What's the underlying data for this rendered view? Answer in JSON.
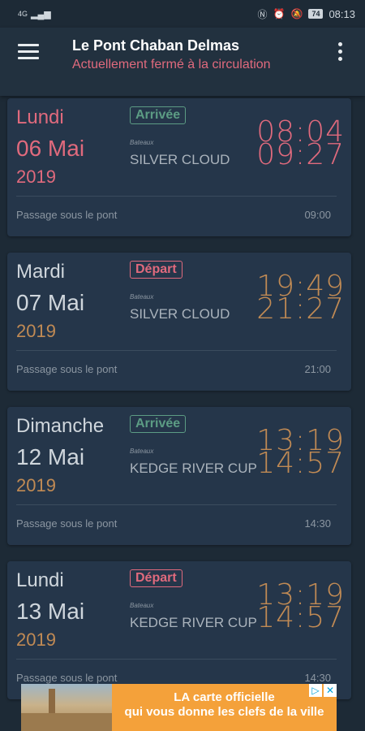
{
  "status_bar": {
    "network": "4G",
    "icons": [
      "nfc-icon",
      "alarm-icon",
      "mute-icon"
    ],
    "battery": "74",
    "time": "08:13"
  },
  "header": {
    "title": "Le Pont Chaban Delmas",
    "subtitle": "Actuellement fermé à la circulation"
  },
  "colors": {
    "accent_red": "#e06a7d",
    "accent_gold": "#c08a54",
    "accent_green": "#5c9c84",
    "card_bg": "#25364a",
    "app_bg": "#1d2a36"
  },
  "cards": [
    {
      "day": "Lundi",
      "date": "06 Mai",
      "year": "2019",
      "type": "Arrivée",
      "ship_logo": "Bateaux",
      "ship": "SILVER CLOUD",
      "time1": "08:04",
      "time2": "09:27",
      "passage_label": "Passage sous le pont",
      "passage_time": "09:00"
    },
    {
      "day": "Mardi",
      "date": "07 Mai",
      "year": "2019",
      "type": "Départ",
      "ship_logo": "Bateaux",
      "ship": "SILVER CLOUD",
      "time1": "19:49",
      "time2": "21:27",
      "passage_label": "Passage sous le pont",
      "passage_time": "21:00"
    },
    {
      "day": "Dimanche",
      "date": "12 Mai",
      "year": "2019",
      "type": "Arrivée",
      "ship_logo": "Bateaux",
      "ship": "KEDGE RIVER CUP",
      "time1": "13:19",
      "time2": "14:57",
      "passage_label": "Passage sous le pont",
      "passage_time": "14:30"
    },
    {
      "day": "Lundi",
      "date": "13 Mai",
      "year": "2019",
      "type": "Départ",
      "ship_logo": "Bateaux",
      "ship": "KEDGE RIVER CUP",
      "time1": "13:19",
      "time2": "14:57",
      "passage_label": "Passage sous le pont",
      "passage_time": "14:30"
    }
  ],
  "ad": {
    "line1": "LA carte officielle",
    "line2": "qui vous donne les clefs de la ville",
    "info": "▷",
    "close": "✕"
  }
}
